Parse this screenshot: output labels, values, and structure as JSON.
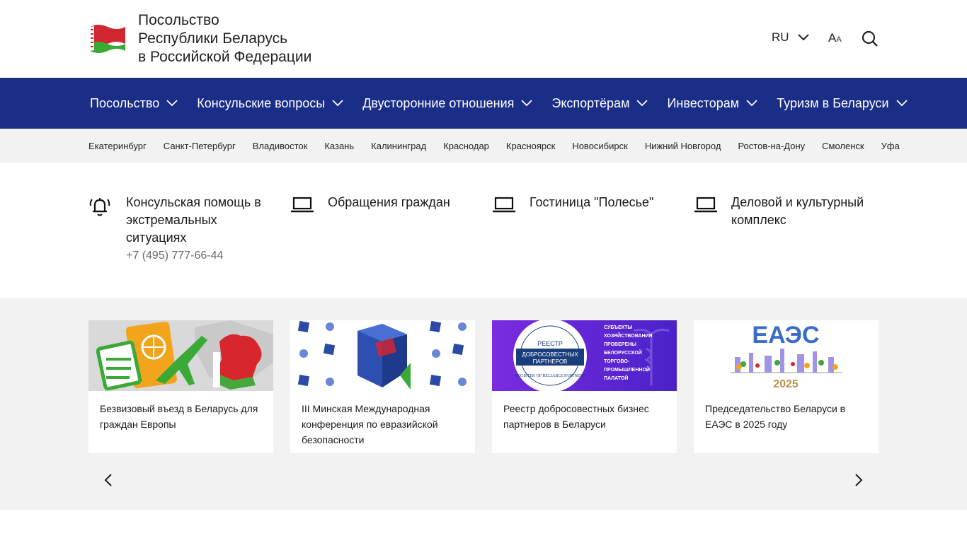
{
  "header": {
    "title_line1": "Посольство",
    "title_line2": "Республики Беларусь",
    "title_line3": "в Российской Федерации",
    "lang": "RU",
    "font_size_label_big": "A",
    "font_size_label_small": "A"
  },
  "main_nav": [
    {
      "label": "Посольство"
    },
    {
      "label": "Консульские вопросы"
    },
    {
      "label": "Двусторонние отношения"
    },
    {
      "label": "Экспортёрам"
    },
    {
      "label": "Инвесторам"
    },
    {
      "label": "Туризм в Беларуси"
    }
  ],
  "cities": [
    "Екатеринбург",
    "Санкт-Петербург",
    "Владивосток",
    "Казань",
    "Калининград",
    "Краснодар",
    "Красноярск",
    "Новосибирск",
    "Нижний Новгород",
    "Ростов-на-Дону",
    "Смоленск",
    "Уфа"
  ],
  "quick_links": [
    {
      "line1": "Консульская помощь в",
      "line2": "экстремальных",
      "line3": "ситуациях",
      "phone": "+7 (495) 777-66-44",
      "icon": "alarm-bell-icon"
    },
    {
      "line1": "Обращения граждан",
      "icon": "laptop-icon"
    },
    {
      "line1": "Гостиница \"Полесье\"",
      "icon": "laptop-icon"
    },
    {
      "line1": "Деловой и культурный",
      "line2": "комплекс",
      "icon": "laptop-icon"
    }
  ],
  "cards": [
    {
      "line1": "Безвизовый въезд в Беларусь для",
      "line2": "граждан Европы",
      "line3": ""
    },
    {
      "line1": "III Минская Международная",
      "line2": "конференция по евразийской",
      "line3": "безопасности"
    },
    {
      "line1": "Реестр добросовестных бизнес",
      "line2": "партнеров в Беларуси",
      "line3": ""
    },
    {
      "line1": "Председательство Беларуси в",
      "line2": "ЕАЭС в 2025 году",
      "line3": ""
    }
  ],
  "card_images": {
    "registry_badge_1": "РЕЕСТР",
    "registry_badge_2": "ДОБРОСОВЕСТНЫХ",
    "registry_badge_3": "ПАРТНЕРОВ",
    "registry_ring": "REGISTER OF RELIABLE PARTNERS",
    "registry_text": [
      "СУБЪЕКТЫ",
      "ХОЗЯЙСТВОВАНИЯ",
      "ПРОВЕРЕНЫ",
      "БЕЛОРУССКОЙ",
      "ТОРГОВО-",
      "ПРОМЫШЛЕННОЙ",
      "ПАЛАТОЙ"
    ],
    "eaes_title": "ЕАЭС",
    "eaes_year": "2025"
  },
  "colors": {
    "nav_bg": "#1a2d87",
    "light_bg": "#f2f2f2",
    "flag_red": "#c8102e",
    "flag_green": "#3aa935"
  }
}
